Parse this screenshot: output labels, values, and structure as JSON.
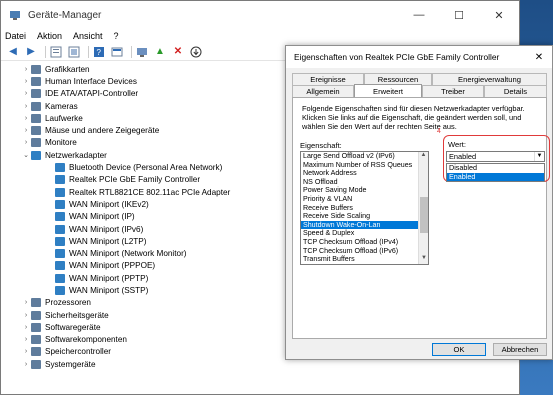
{
  "window": {
    "title": "Geräte-Manager",
    "controls": [
      "—",
      "☐",
      "✕"
    ]
  },
  "menu": [
    "Datei",
    "Aktion",
    "Ansicht",
    "?"
  ],
  "tree": [
    {
      "label": "Grafikkarten",
      "level": 1,
      "expanded": false,
      "icon": "display-adapter-icon"
    },
    {
      "label": "Human Interface Devices",
      "level": 1,
      "expanded": false,
      "icon": "hid-icon"
    },
    {
      "label": "IDE ATA/ATAPI-Controller",
      "level": 1,
      "expanded": false,
      "icon": "ide-icon"
    },
    {
      "label": "Kameras",
      "level": 1,
      "expanded": false,
      "icon": "camera-icon"
    },
    {
      "label": "Laufwerke",
      "level": 1,
      "expanded": false,
      "icon": "drive-icon"
    },
    {
      "label": "Mäuse und andere Zeigegeräte",
      "level": 1,
      "expanded": false,
      "icon": "mouse-icon"
    },
    {
      "label": "Monitore",
      "level": 1,
      "expanded": false,
      "icon": "monitor-icon"
    },
    {
      "label": "Netzwerkadapter",
      "level": 1,
      "expanded": true,
      "icon": "network-icon"
    },
    {
      "label": "Bluetooth Device (Personal Area Network)",
      "level": 2,
      "icon": "network-icon"
    },
    {
      "label": "Realtek PCIe GbE Family Controller",
      "level": 2,
      "icon": "network-icon"
    },
    {
      "label": "Realtek RTL8821CE 802.11ac PCIe Adapter",
      "level": 2,
      "icon": "network-icon"
    },
    {
      "label": "WAN Miniport (IKEv2)",
      "level": 2,
      "icon": "network-icon"
    },
    {
      "label": "WAN Miniport (IP)",
      "level": 2,
      "icon": "network-icon"
    },
    {
      "label": "WAN Miniport (IPv6)",
      "level": 2,
      "icon": "network-icon"
    },
    {
      "label": "WAN Miniport (L2TP)",
      "level": 2,
      "icon": "network-icon"
    },
    {
      "label": "WAN Miniport (Network Monitor)",
      "level": 2,
      "icon": "network-icon"
    },
    {
      "label": "WAN Miniport (PPPOE)",
      "level": 2,
      "icon": "network-icon"
    },
    {
      "label": "WAN Miniport (PPTP)",
      "level": 2,
      "icon": "network-icon"
    },
    {
      "label": "WAN Miniport (SSTP)",
      "level": 2,
      "icon": "network-icon"
    },
    {
      "label": "Prozessoren",
      "level": 1,
      "expanded": false,
      "icon": "cpu-icon"
    },
    {
      "label": "Sicherheitsgeräte",
      "level": 1,
      "expanded": false,
      "icon": "security-icon"
    },
    {
      "label": "Softwaregeräte",
      "level": 1,
      "expanded": false,
      "icon": "software-icon"
    },
    {
      "label": "Softwarekomponenten",
      "level": 1,
      "expanded": false,
      "icon": "component-icon"
    },
    {
      "label": "Speichercontroller",
      "level": 1,
      "expanded": false,
      "icon": "storage-icon"
    },
    {
      "label": "Systemgeräte",
      "level": 1,
      "expanded": false,
      "icon": "system-icon"
    }
  ],
  "dialog": {
    "title": "Eigenschaften von Realtek PCIe GbE Family Controller",
    "close": "✕",
    "tabs_row1": [
      "Ereignisse",
      "Ressourcen",
      "Energieverwaltung"
    ],
    "tabs_row2": [
      "Allgemein",
      "Erweitert",
      "Treiber",
      "Details"
    ],
    "active_tab": "Erweitert",
    "description": "Folgende Eigenschaften sind für diesen Netzwerkadapter verfügbar. Klicken Sie links auf die Eigenschaft, die geändert werden soll, und wählen Sie den Wert auf der rechten Seite aus.",
    "property_label": "Eigenschaft:",
    "value_label": "Wert:",
    "highlight_number": "4",
    "properties": [
      "Large Send Offload v2 (IPv6)",
      "Maximum Number of RSS Queues",
      "Network Address",
      "NS Offload",
      "Power Saving Mode",
      "Priority & VLAN",
      "Receive Buffers",
      "Receive Side Scaling",
      "Shutdown Wake-On-Lan",
      "Speed & Duplex",
      "TCP Checksum Offload (IPv4)",
      "TCP Checksum Offload (IPv6)",
      "Transmit Buffers"
    ],
    "selected_property": "Shutdown Wake-On-Lan",
    "value_selected": "Enabled",
    "value_options": [
      "Disabled",
      "Enabled"
    ],
    "ok_label": "OK",
    "cancel_label": "Abbrechen"
  }
}
